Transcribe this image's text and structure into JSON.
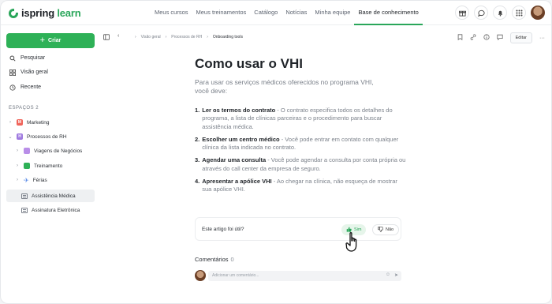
{
  "brand": {
    "name_part1": "ispring",
    "name_part2": "learn",
    "accent": "#2eb157"
  },
  "nav": {
    "items": [
      "Meus cursos",
      "Meus treinamentos",
      "Catálogo",
      "Notícias",
      "Minha equipe",
      "Base de conhecimento"
    ],
    "active_index": 5
  },
  "top_icons": [
    "gift-icon",
    "chat-icon",
    "bell-icon",
    "grid-icon"
  ],
  "sidebar": {
    "create_label": "Criar",
    "links": [
      {
        "label": "Pesquisar",
        "icon": "search-icon"
      },
      {
        "label": "Visão geral",
        "icon": "overview-icon"
      },
      {
        "label": "Recente",
        "icon": "clock-icon"
      }
    ],
    "spaces_label": "ESPAÇOS 2",
    "tree": [
      {
        "label": "Marketing",
        "badge": "M",
        "badge_color": "#f0645a"
      },
      {
        "label": "Processos de RH",
        "badge": "H",
        "badge_color": "#a07be0"
      },
      {
        "label": "Viagens de Negócios",
        "badge_color": "#b98ee8"
      },
      {
        "label": "Treinamento",
        "badge_color": "#2eb157"
      },
      {
        "label": "Férias",
        "badge_color": "#5b8de8"
      },
      {
        "label": "Assistência Médica"
      },
      {
        "label": "Assinatura Eletrônica"
      }
    ]
  },
  "breadcrumb": {
    "items": [
      "Visão geral",
      "Processos de RH",
      "Onboarding tools"
    ]
  },
  "toolbar": {
    "edit_label": "Editar"
  },
  "article": {
    "title": "Como usar o VHI",
    "intro": "Para usar os serviços médicos oferecidos no programa VHI, você deve:",
    "steps": [
      {
        "num": "1.",
        "bold": "Ler os termos do contrato",
        "text": " - O contrato especifica todos os detalhes do programa, a lista de clínicas parceiras e o procedimento para buscar assistência médica."
      },
      {
        "num": "2.",
        "bold": "Escolher um centro médico",
        "text": "  - Você pode entrar em contato com qualquer clínica da lista indicada no contrato."
      },
      {
        "num": "3.",
        "bold": "Agendar uma consulta",
        "text": " - Você pode agendar a consulta por conta própria ou através do call center da empresa de seguro."
      },
      {
        "num": "4.",
        "bold": "Apresentar a apólice VHI",
        "text": " - Ao chegar na clínica, não esqueça de mostrar sua apólice VHI."
      }
    ]
  },
  "feedback": {
    "question": "Este artigo foi útil?",
    "yes_label": "Sim",
    "no_label": "Não"
  },
  "comments": {
    "label": "Comentários",
    "count": "0",
    "placeholder": "Adicionar um comentário..."
  }
}
